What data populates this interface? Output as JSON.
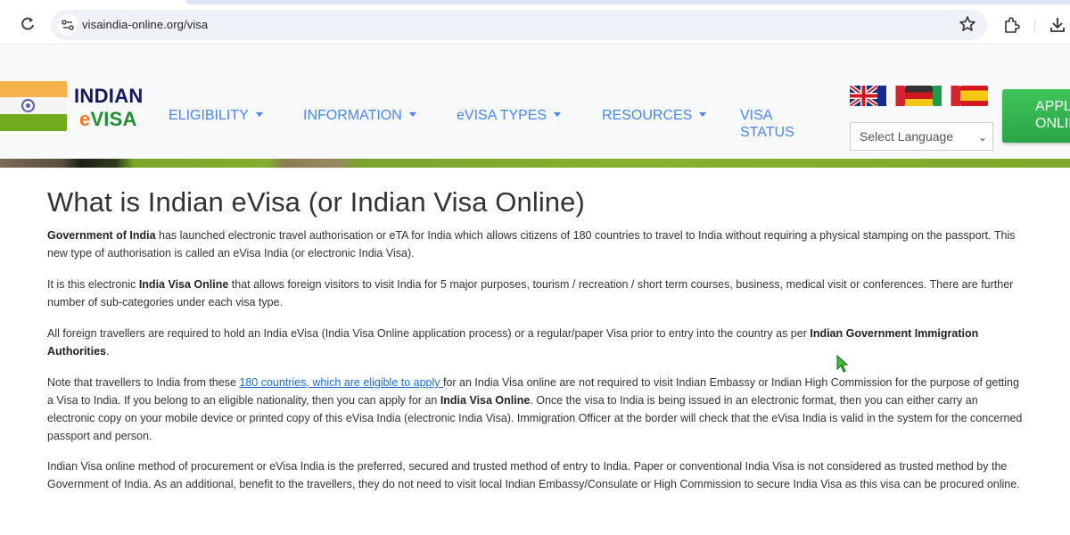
{
  "browser": {
    "url": "visaindia-online.org/visa",
    "icons": {
      "back": "back-arrow-icon",
      "reload": "reload-icon",
      "site_info": "tune-icon",
      "bookmark": "star-icon",
      "extensions": "puzzle-icon",
      "download": "download-icon"
    }
  },
  "header": {
    "logo_line1": "INDIAN",
    "logo_line2_prefix": "e",
    "logo_line2_rest": "VISA",
    "nav": [
      {
        "label": "ELIGIBILITY"
      },
      {
        "label": "INFORMATION"
      },
      {
        "label": "eVISA TYPES"
      },
      {
        "label": "RESOURCES"
      }
    ],
    "visa_status_line1": "VISA",
    "visa_status_line2": "STATUS",
    "language_flags": [
      "English (UK)",
      "French",
      "German",
      "Italian",
      "Spanish"
    ],
    "language_select": "Select Language",
    "apply_line1": "APPLY",
    "apply_line2": "ONLINE"
  },
  "colors": {
    "nav_blue": "#4a86f0",
    "apply_green": "#2aa546",
    "logo_navy": "#13195d",
    "logo_green": "#1f8f2e",
    "logo_orange": "#ef7c25",
    "link_blue": "#1b6ee0"
  },
  "main": {
    "title": "What is Indian eVisa (or Indian Visa Online)",
    "p1": {
      "bold": "Government of India",
      "text": " has launched electronic travel authorisation or eTA for India which allows citizens of 180 countries to travel to India without requiring a physical stamping on the passport. This new type of authorisation is called an eVisa India (or electronic India Visa)."
    },
    "p2": {
      "pre": "It is this electronic ",
      "bold": "India Visa Online",
      "post": " that allows foreign visitors to visit India for 5 major purposes, tourism / recreation / short term courses, business, medical visit or conferences. There are further number of sub-categories under each visa type."
    },
    "p3": {
      "pre": "All foreign travellers are required to hold an India eVisa (India Visa Online application process) or a regular/paper Visa prior to entry into the country as per ",
      "bold": "Indian Government Immigration Authorities",
      "post": "."
    },
    "p4": {
      "pre": "Note that travellers to India from these ",
      "link": "180 countries, which are eligible to apply ",
      "mid": "for an India Visa online are not required to visit Indian Embassy or Indian High Commission for the purpose of getting a Visa to India. If you belong to an eligible nationality, then you can apply for an ",
      "bold": "India Visa Online",
      "post": ". Once the visa to India is being issued in an electronic format, then you can either carry an electronic copy on your mobile device or printed copy of this eVisa India (electronic India Visa). Immigration Officer at the border will check that the eVisa India is valid in the system for the concerned passport and person."
    },
    "p5": {
      "text": "Indian Visa online method of procurement or eVisa India is the preferred, secured and trusted method of entry to India. Paper or conventional India Visa is not considered as trusted method by the Government of India. As an additional, benefit to the travellers, they do not need to visit local Indian Embassy/Consulate or High Commission to secure India Visa as this visa can be procured online."
    }
  }
}
